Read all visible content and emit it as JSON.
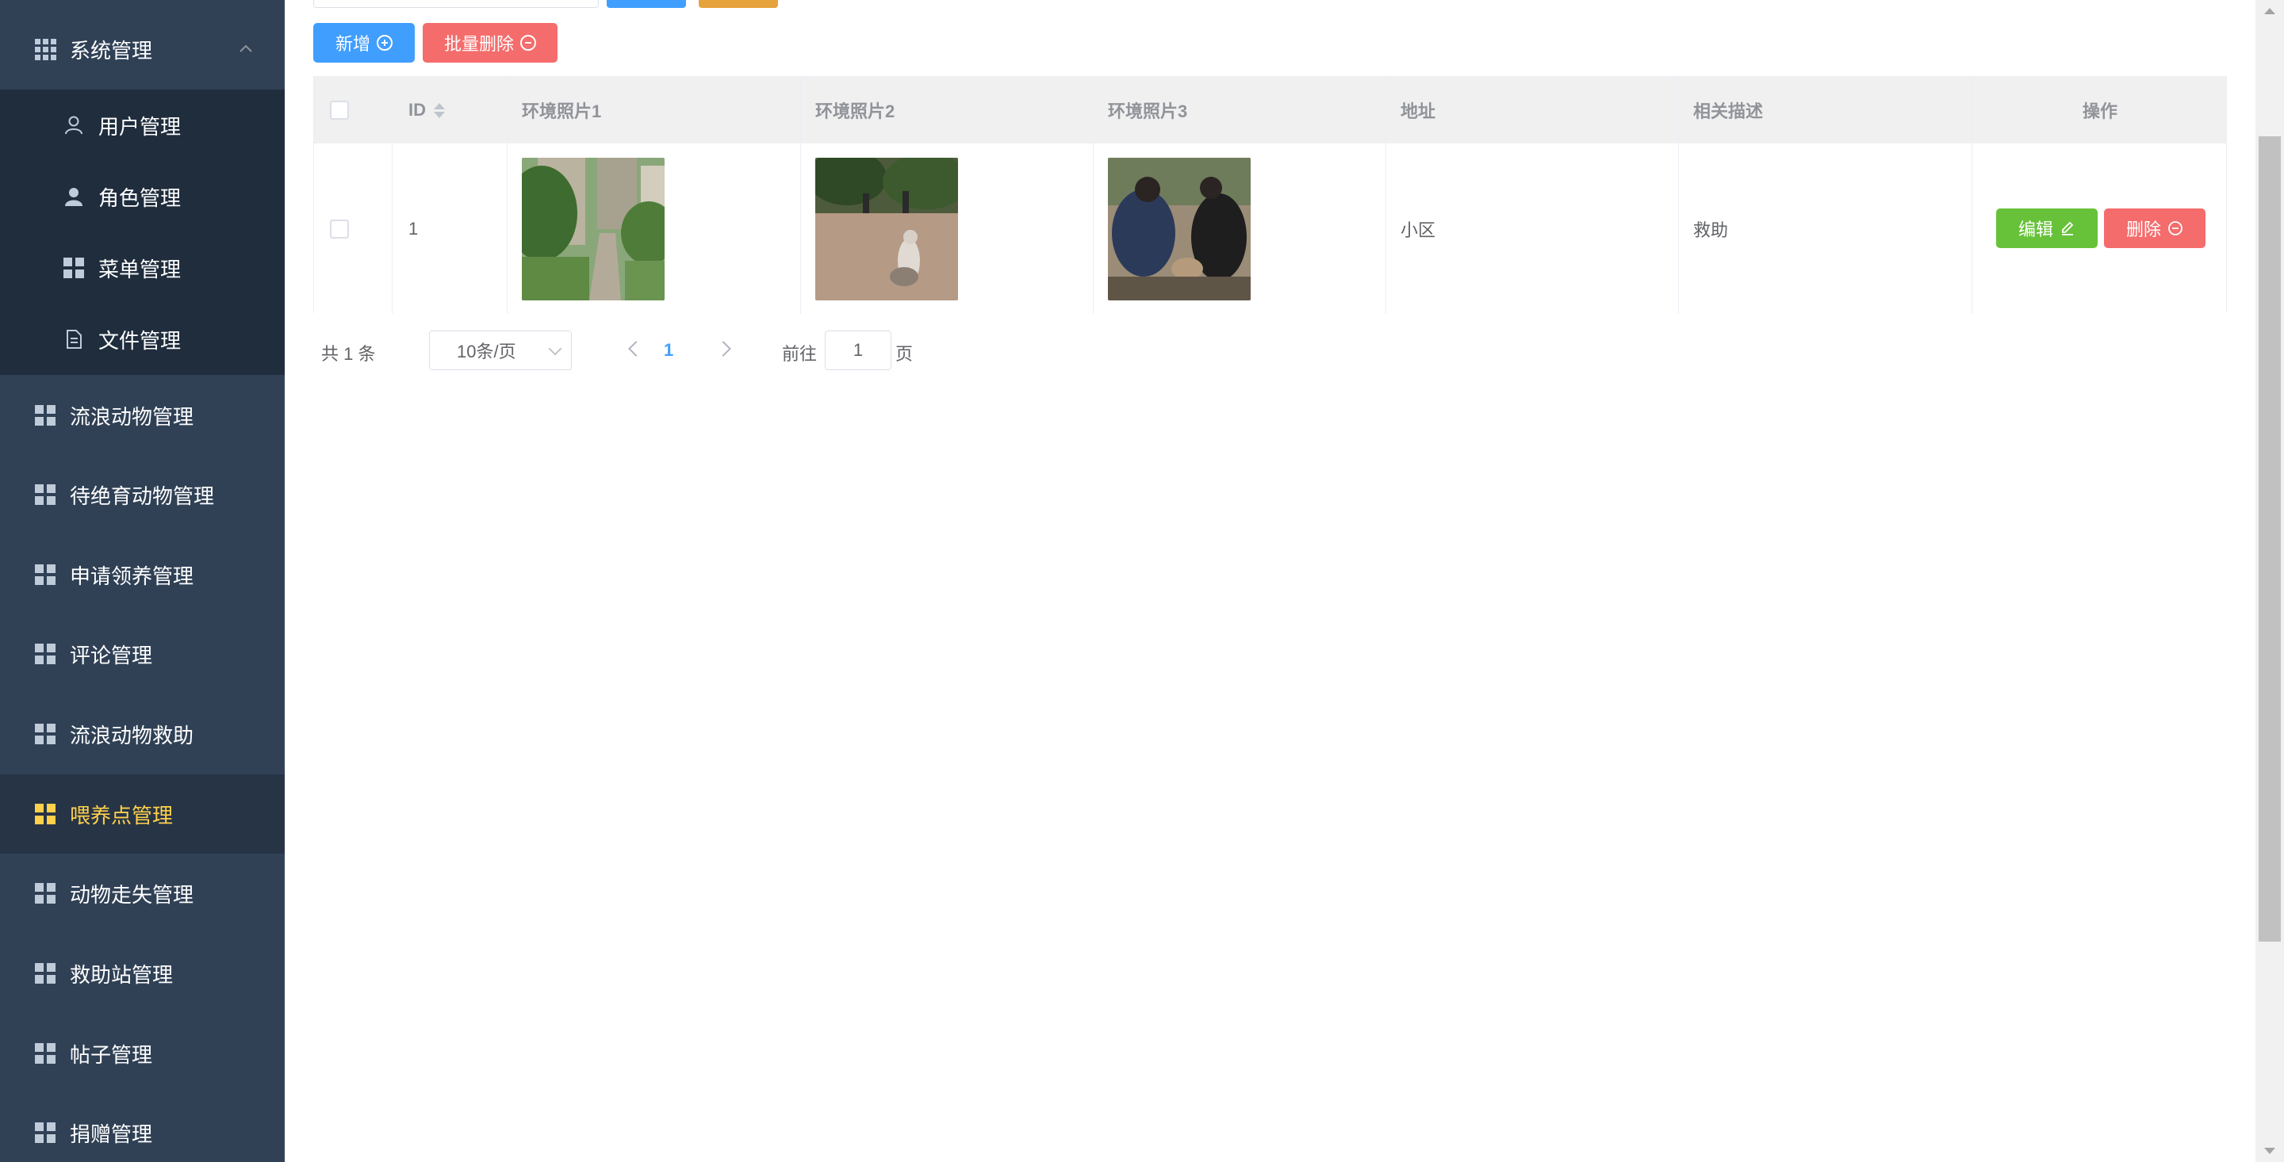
{
  "sidebar": {
    "system": {
      "label": "系统管理",
      "icon": "grid-icon",
      "expanded": true
    },
    "sub_items": [
      {
        "label": "用户管理",
        "icon": "user-outline-icon"
      },
      {
        "label": "角色管理",
        "icon": "user-filled-icon"
      },
      {
        "label": "菜单管理",
        "icon": "menu-grid-icon"
      },
      {
        "label": "文件管理",
        "icon": "document-icon"
      }
    ],
    "items": [
      {
        "label": "流浪动物管理",
        "icon": "grid-icon"
      },
      {
        "label": "待绝育动物管理",
        "icon": "grid-icon"
      },
      {
        "label": "申请领养管理",
        "icon": "grid-icon"
      },
      {
        "label": "评论管理",
        "icon": "grid-icon"
      },
      {
        "label": "流浪动物救助",
        "icon": "grid-icon"
      },
      {
        "label": "喂养点管理",
        "icon": "grid-icon",
        "active": true
      },
      {
        "label": "动物走失管理",
        "icon": "grid-icon"
      },
      {
        "label": "救助站管理",
        "icon": "grid-icon"
      },
      {
        "label": "帖子管理",
        "icon": "grid-icon"
      },
      {
        "label": "捐赠管理",
        "icon": "grid-icon"
      }
    ],
    "colors": {
      "bg": "#304156",
      "sub_bg": "#1f2d3d",
      "active_text": "#ffd04b"
    }
  },
  "toolbar": {
    "add_label": "新增",
    "batch_delete_label": "批量删除"
  },
  "table": {
    "headers": {
      "id": "ID",
      "photo1": "环境照片1",
      "photo2": "环境照片2",
      "photo3": "环境照片3",
      "address": "地址",
      "description": "相关描述",
      "actions": "操作"
    },
    "rows": [
      {
        "id": "1",
        "address": "小区",
        "description": "救助",
        "edit_label": "编辑",
        "delete_label": "删除"
      }
    ]
  },
  "pagination": {
    "total": "共 1 条",
    "page_size": "10条/页",
    "current_page": "1",
    "goto_prefix": "前往",
    "goto_value": "1",
    "goto_suffix": "页"
  },
  "colors": {
    "primary": "#409eff",
    "danger": "#f56c6c",
    "success": "#67c23a",
    "warning": "#e6a23c"
  }
}
